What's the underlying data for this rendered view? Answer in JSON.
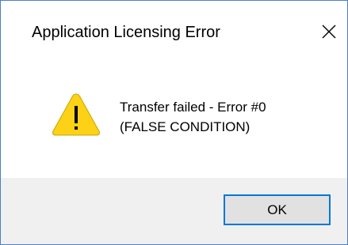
{
  "dialog": {
    "title": "Application Licensing Error",
    "icon": "warning-icon",
    "message_line1": "Transfer failed - Error #0",
    "message_line2": "(FALSE CONDITION)",
    "ok_label": "OK",
    "close_icon": "close-icon"
  },
  "colors": {
    "accent_border": "#0078d7",
    "window_border": "#4a7fc7",
    "warning_fill": "#fcd116",
    "footer_bg": "#f0f0f0"
  }
}
